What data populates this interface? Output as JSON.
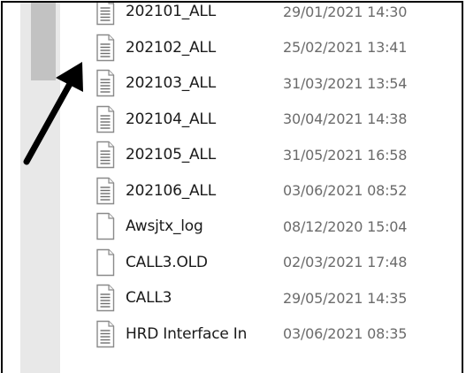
{
  "files": [
    {
      "name": "202101_ALL",
      "date": "29/01/2021 14:30",
      "icon": "text-file-icon"
    },
    {
      "name": "202102_ALL",
      "date": "25/02/2021 13:41",
      "icon": "text-file-icon"
    },
    {
      "name": "202103_ALL",
      "date": "31/03/2021 13:54",
      "icon": "text-file-icon"
    },
    {
      "name": "202104_ALL",
      "date": "30/04/2021 14:38",
      "icon": "text-file-icon"
    },
    {
      "name": "202105_ALL",
      "date": "31/05/2021 16:58",
      "icon": "text-file-icon"
    },
    {
      "name": "202106_ALL",
      "date": "03/06/2021 08:52",
      "icon": "text-file-icon"
    },
    {
      "name": "Awsjtx_log",
      "date": "08/12/2020 15:04",
      "icon": "blank-file-icon"
    },
    {
      "name": "CALL3.OLD",
      "date": "02/03/2021 17:48",
      "icon": "blank-file-icon"
    },
    {
      "name": "CALL3",
      "date": "29/05/2021 14:35",
      "icon": "text-file-icon"
    },
    {
      "name": "HRD Interface In",
      "date": "03/06/2021 08:35",
      "icon": "text-file-icon"
    }
  ],
  "colors": {
    "frame_border": "#000000",
    "scrollbar_track": "#e8e8e8",
    "scrollbar_thumb": "#c2c2c2",
    "name_text": "#1a1a1a",
    "date_text": "#6b6b6b",
    "annotation_arrow": "#000000"
  }
}
